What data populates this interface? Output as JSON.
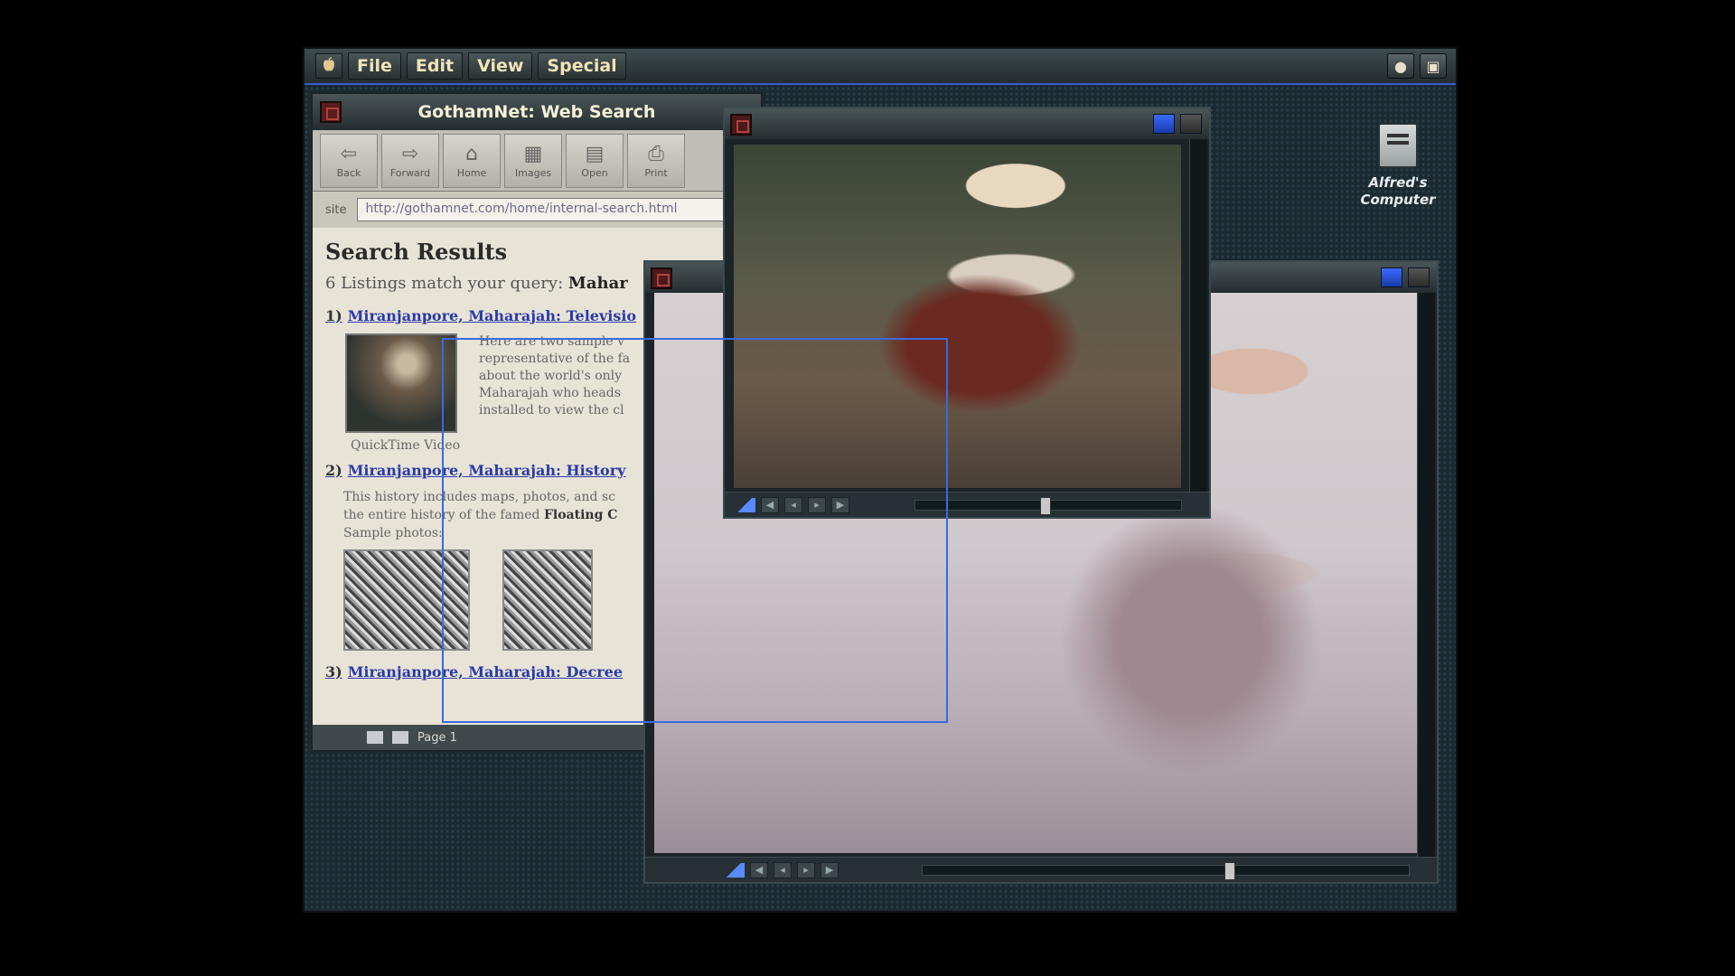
{
  "menubar": {
    "items": [
      "File",
      "Edit",
      "View",
      "Special"
    ]
  },
  "desktop": {
    "icon_label": "Alfred's Computer"
  },
  "browser": {
    "title": "GothamNet: Web Search",
    "toolbar": [
      "Back",
      "Forward",
      "Home",
      "Images",
      "Open",
      "Print"
    ],
    "url_label": "site",
    "url": "http://gothamnet.com/home/internal-search.html",
    "heading": "Search Results",
    "query_prefix": "6 Listings match your query:",
    "query_term": "Mahar",
    "results": [
      {
        "num": "1)",
        "title": "Miranjanpore, Maharajah: Televisio"
      },
      {
        "num": "2)",
        "title": "Miranjanpore, Maharajah: History"
      },
      {
        "num": "3)",
        "title": "Miranjanpore, Maharajah: Decree"
      }
    ],
    "r1_desc": [
      "Here are two sample v",
      "representative of the fa",
      "about the world's only",
      "Maharajah who heads",
      "installed to view the cl"
    ],
    "r1_caption": "QuickTime Video",
    "r2_desc_a": "This history includes maps, photos, and sc",
    "r2_desc_b_prefix": "the entire history of the famed",
    "r2_desc_b_bold": "Floating C",
    "r2_sample": "Sample photos:",
    "status": "Page 1"
  },
  "colors": {
    "accent": "#3a6ae0",
    "link": "#2a3aaa",
    "menu_text": "#f0e4b8"
  }
}
